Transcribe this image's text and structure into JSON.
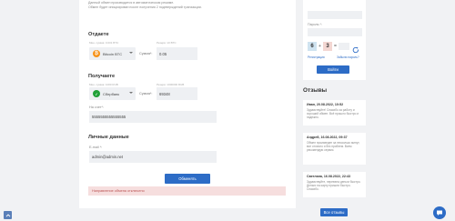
{
  "notice": {
    "line1": "Данный обмен производится в автоматическом режиме.",
    "line2": "Обмен будет инициирован после получения 2 подтверждений транзакции."
  },
  "give": {
    "title": "Отдаете",
    "tiny_left": "Мин. сумма: 0.001 BTC",
    "tiny_right": "Резерв: 10 BTC",
    "currency": "Bitcoin BTC",
    "amount_label": "Сумма*:",
    "amount": "0.05"
  },
  "get": {
    "title": "Получаете",
    "tiny_left": "Мин. сумма: 1000 RUB",
    "tiny_right": "Резерв: 1000000 RUB",
    "currency": "Сбербанк",
    "amount_label": "Сумма*:",
    "amount": "69348",
    "card_label": "На счет*:",
    "card_value": "5555555555555555"
  },
  "personal": {
    "title": "Личные данные",
    "email_label": "E-mail *:",
    "email_value": "admin@admin.net"
  },
  "exchange_button": "Обменять",
  "error_text": "Направление обмена отключено",
  "login": {
    "password_label": "Пароль *:",
    "captcha_a": "6",
    "captcha_op": "+",
    "captcha_b": "3",
    "captcha_eq": "=",
    "login_button": "Войти",
    "register_link": "Регистрация",
    "forgot_link": "Забыли пароль?"
  },
  "reviews": {
    "title": "Отзывы",
    "items": [
      {
        "author": "Иван, 20.08.2022, 10:52",
        "text": "Здравствуйте! Спасибо за работу и хороший обмен. Всё прошло быстро и надежно."
      },
      {
        "author": "Андрей, 16.08.2022, 09:37",
        "text": "Обмен произведен за несколько минут, все отлично и без проблем. Всем рекомендую сервис."
      },
      {
        "author": "Светлана, 16.08.2022, 22:43",
        "text": "Здравствуйте, перевела деньги быстро. Деньги на карту пришли быстро. Спасибо."
      }
    ],
    "all_button": "Все отзывы"
  },
  "colors": {
    "accent": "#2d6cc6",
    "error_bg": "#f6dede",
    "btc": "#f7931a",
    "sber": "#21a038"
  },
  "icons": {
    "scroll_top": "arrow-up-icon",
    "chat": "chat-bubble-icon",
    "refresh": "refresh-icon"
  }
}
